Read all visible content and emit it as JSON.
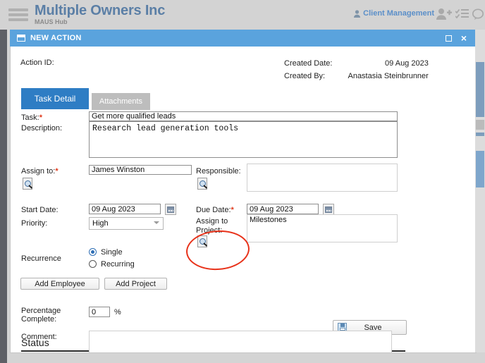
{
  "appbar": {
    "menu_icon": "hamburger-icon",
    "company": "Multiple Owners Inc",
    "product": "MAUS Hub",
    "client_management": "Client Management",
    "icons": [
      "add-user-icon",
      "checklist-icon",
      "chat-bubble-icon"
    ],
    "brand_color": "#5b7fa6",
    "link_color": "#5b8fc9"
  },
  "window": {
    "title": "NEW ACTION",
    "title_bar_color": "#5aa3dd",
    "maximize_label": "□",
    "close_label": "×"
  },
  "form": {
    "action_id_label": "Action ID:",
    "action_id_value": "",
    "created_date_label": "Created Date:",
    "created_date_value": "09 Aug 2023",
    "created_by_label": "Created By:",
    "created_by_value": "Anastasia Steinbrunner",
    "tabs": [
      {
        "label": "Task Detail",
        "active": true
      },
      {
        "label": "Attachments",
        "active": false
      }
    ],
    "task_label": "Task:",
    "task_required": "*",
    "task_value": "Get more qualified leads",
    "description_label": "Description:",
    "description_value": "Research lead generation tools",
    "assign_to_label": "Assign to:",
    "assign_to_required": "*",
    "assign_to_value": "James Winston",
    "assign_to_search_icon": "search-icon",
    "responsible_label": "Responsible:",
    "responsible_value": "",
    "responsible_search_icon": "search-icon",
    "start_date_label": "Start Date:",
    "start_date_value": "09 Aug 2023",
    "due_date_label": "Due Date:",
    "due_date_required": "*",
    "due_date_value": "09 Aug 2023",
    "calendar_icon": "calendar-icon",
    "priority_label": "Priority:",
    "priority_value": "High",
    "priority_options": [
      "High"
    ],
    "assign_to_project_label": "Assign to Project:",
    "assign_to_project_search_icon": "search-icon",
    "project_value": "Milestones",
    "recurrence_label": "Recurrence",
    "recurrence_options": [
      {
        "label": "Single",
        "selected": true
      },
      {
        "label": "Recurring",
        "selected": false
      }
    ],
    "add_employee_label": "Add Employee",
    "add_project_label": "Add Project",
    "save_label": "Save",
    "save_icon": "floppy-disk-icon"
  },
  "status": {
    "heading": "Status",
    "percentage_label": "Percentage Complete:",
    "percentage_value": "0",
    "percent_sign": "%",
    "comment_label": "Comment:",
    "comment_value": ""
  },
  "annotation": {
    "shape": "red-ellipse-highlight",
    "color": "#e8321a",
    "targets": "assign-to-project-field"
  }
}
